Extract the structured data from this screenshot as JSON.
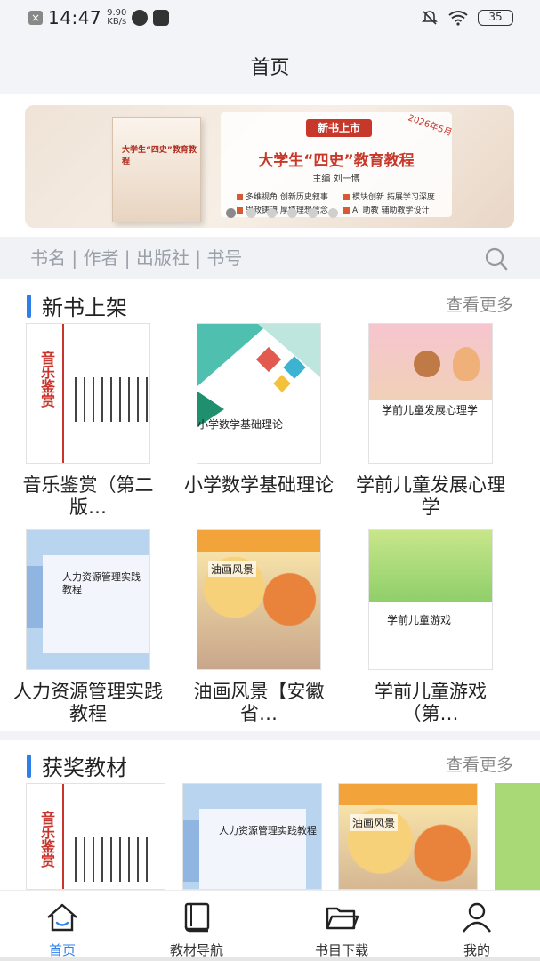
{
  "status_bar": {
    "time": "14:47",
    "net_speed_value": "9.90",
    "net_speed_unit": "KB/s",
    "battery": "35"
  },
  "header": {
    "title": "首页"
  },
  "banner": {
    "tag": "新书上市",
    "date_tag": "2026年5月",
    "headline": "大学生“四史”教育教程",
    "editor": "主编 刘一博",
    "book_title": "大学生“四史”教育教程",
    "features": [
      "多维视角 创新历史叙事",
      "模块创新 拓展学习深度",
      "思政铸魂 厚植理想信念",
      "AI 助教 辅助教学设计"
    ],
    "dots": 6,
    "active_dot": 0
  },
  "search": {
    "placeholder": "书名 | 作者 | 出版社 | 书号"
  },
  "new_books": {
    "title": "新书上架",
    "more": "查看更多",
    "items": [
      {
        "name": "音乐鉴赏（第二版…",
        "cover": "music",
        "cover_text": "音乐鉴赏"
      },
      {
        "name": "小学数学基础理论",
        "cover": "math",
        "cover_text": "小学数学基础理论"
      },
      {
        "name": "学前儿童发展心理学",
        "cover": "child",
        "cover_text": "学前儿童发展心理学"
      },
      {
        "name": "人力资源管理实践教程",
        "cover": "hr",
        "cover_text": "人力资源管理实践教程"
      },
      {
        "name": "油画风景【安徽省…",
        "cover": "oil",
        "cover_text": "油画风景"
      },
      {
        "name": "学前儿童游戏（第…",
        "cover": "game",
        "cover_text": "学前儿童游戏"
      }
    ]
  },
  "award_books": {
    "title": "获奖教材",
    "more": "查看更多",
    "items": [
      {
        "cover": "music",
        "cover_text": "音乐鉴赏"
      },
      {
        "cover": "hr",
        "cover_text": "人力资源管理实践教程"
      },
      {
        "cover": "oil",
        "cover_text": "油画风景"
      }
    ]
  },
  "bottom_nav": [
    {
      "label": "首页",
      "icon": "home-icon",
      "active": true
    },
    {
      "label": "教材导航",
      "icon": "book-icon",
      "active": false
    },
    {
      "label": "书目下载",
      "icon": "folder-icon",
      "active": false
    },
    {
      "label": "我的",
      "icon": "user-icon",
      "active": false
    }
  ],
  "colors": {
    "accent": "#2f7fe8",
    "banner_red": "#c8382a"
  }
}
